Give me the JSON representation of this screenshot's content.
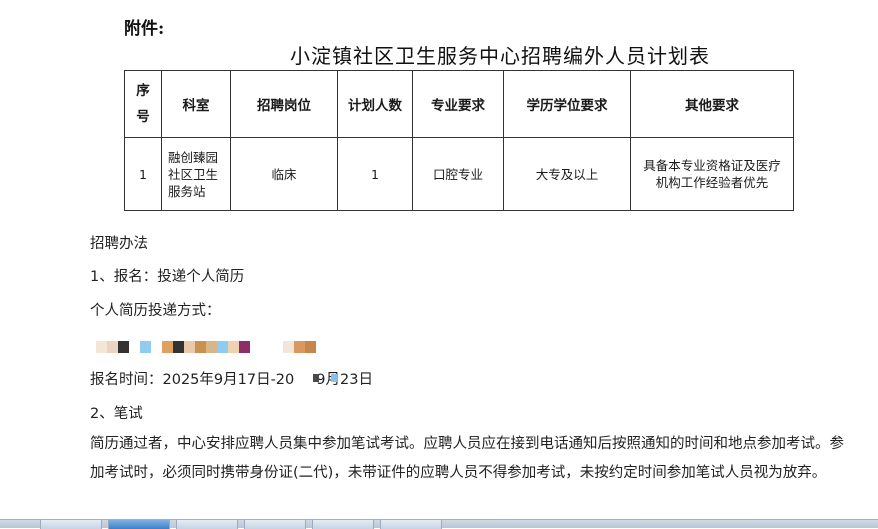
{
  "attachment_label": "附件:",
  "title": "小淀镇社区卫生服务中心招聘编外人员计划表",
  "table": {
    "headers": [
      "序\n号",
      "科室",
      "招聘岗位",
      "计划人数",
      "专业要求",
      "学历学位要求",
      "其他要求"
    ],
    "rows": [
      [
        "1",
        "融创臻园\n社区卫生\n服务站",
        "临床",
        "1",
        "口腔专业",
        "大专及以上",
        "具备本专业资格证及医疗\n机构工作经验者优先"
      ]
    ]
  },
  "body": {
    "method_heading": "招聘办法",
    "step1": "1、报名：投递个人简历",
    "resume_label": "个人简历投递方式：",
    "redacted_colors": [
      "#f4e6d6",
      "#e9d5c1",
      "#333333",
      "#ffffff",
      "#8fcdf0",
      "#ffffff",
      "#e0a060",
      "#333333",
      "#e9c9a8",
      "#c9924f",
      "#d9b68a",
      "#8fcdf0",
      "#f0d2b0",
      "#8e2d6a",
      "#ffffff",
      "#ffffff",
      "#ffffff",
      "#f4e6d6",
      "#d99860",
      "#c8874a"
    ],
    "reg_time_prefix": "报名时间：2025年9月17日-20",
    "reg_time_suffix": "9月23日",
    "step2": "2、笔试",
    "exam_paragraph": "简历通过者，中心安排应聘人员集中参加笔试考试。应聘人员应在接到电话通知后按照通知的时间和地点参加考试。参加考试时，必须同时携带身份证(二代)，未带证件的应聘人员不得参加考试，未按约定时间参加笔试人员视为放弃。"
  },
  "colors": {
    "text": "#222222",
    "table_border": "#333333",
    "taskbar": "#b8c6d8",
    "taskbar_active": "#3d7fc7"
  }
}
